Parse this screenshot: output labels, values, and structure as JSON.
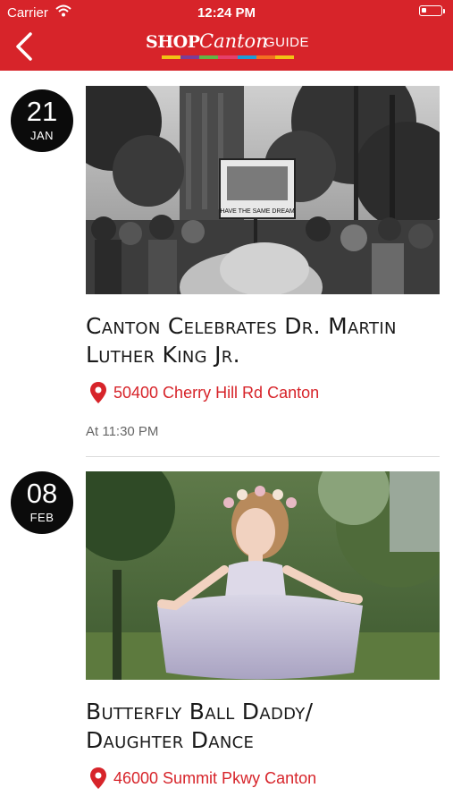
{
  "status_bar": {
    "carrier": "Carrier",
    "time": "12:24 PM"
  },
  "header": {
    "logo_shop": "SHOP",
    "logo_canton": "Canton",
    "logo_guide": "GUIDE",
    "accent_color": "#d7242a"
  },
  "events": [
    {
      "day": "21",
      "month": "JAN",
      "title_line1": "Canton Celebrates Dr. Martin",
      "title_line2": "Luther King Jr.",
      "location": "50400 Cherry Hill Rd Canton",
      "time": "At  11:30 PM",
      "sign_text": "HAVE THE SAME DREAM"
    },
    {
      "day": "08",
      "month": "FEB",
      "title_line1": "Butterfly Ball Daddy/",
      "title_line2": "Daughter Dance",
      "location": "46000 Summit Pkwy Canton"
    }
  ]
}
